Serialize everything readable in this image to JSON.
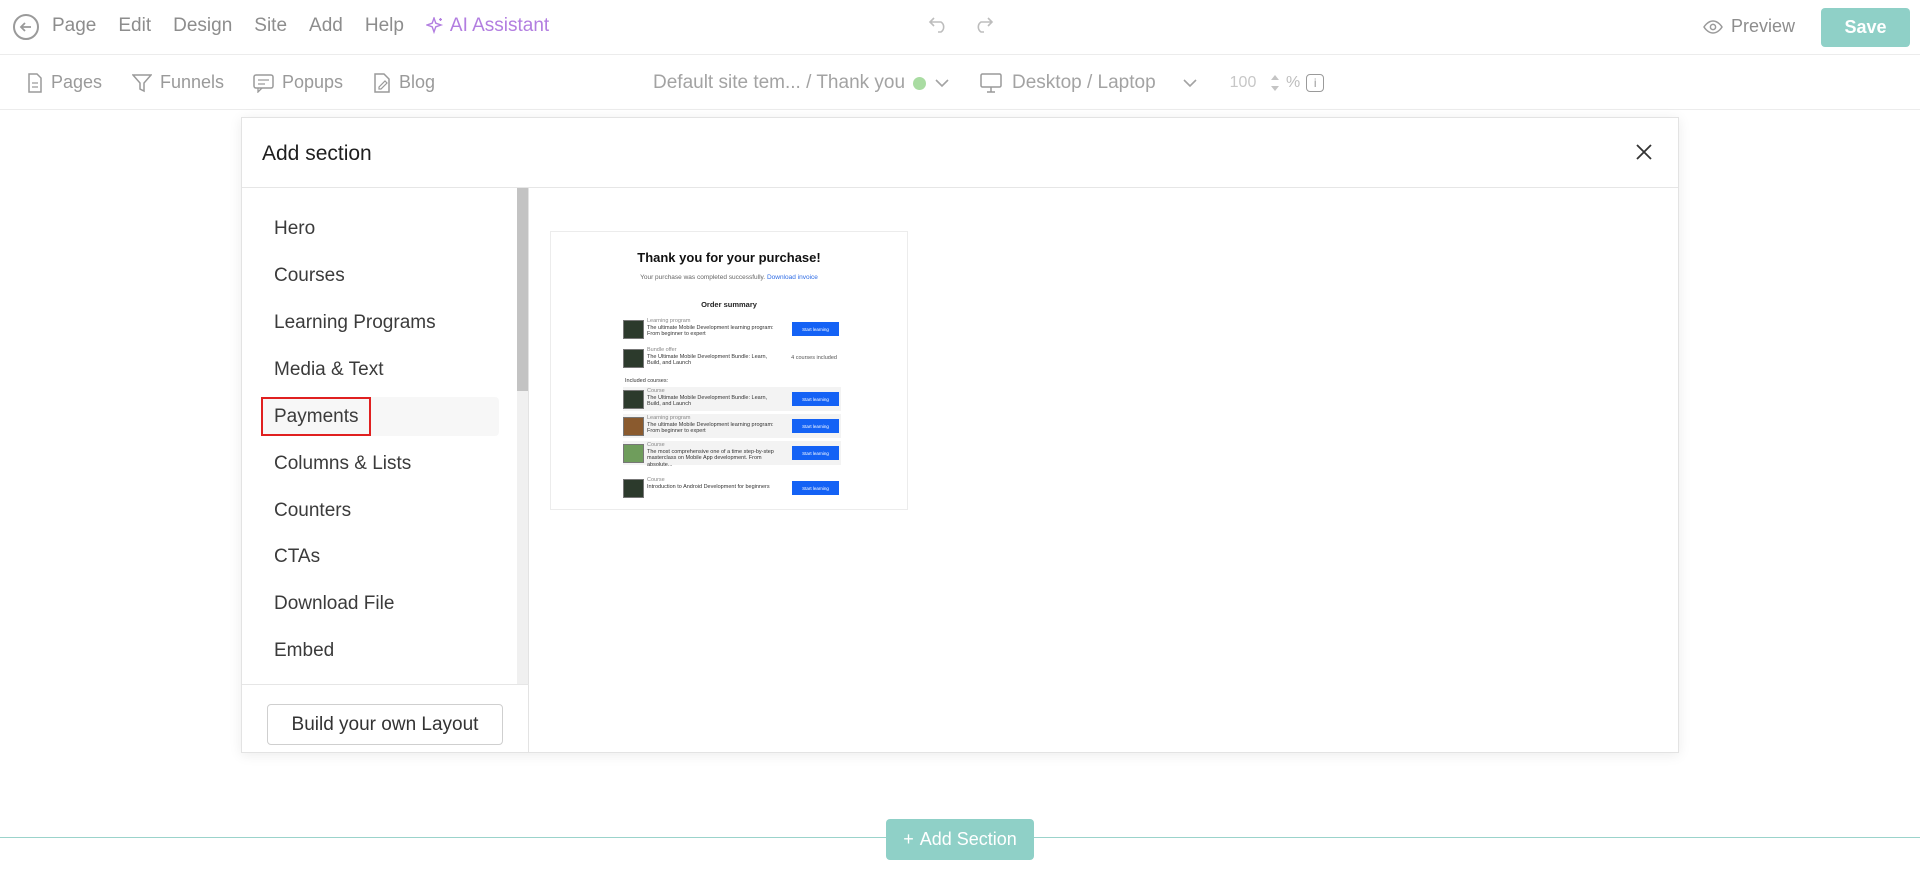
{
  "topbar": {
    "menu": [
      "Page",
      "Edit",
      "Design",
      "Site",
      "Add",
      "Help"
    ],
    "ai_label": "AI Assistant",
    "preview_label": "Preview",
    "save_label": "Save"
  },
  "subbar": {
    "nav": [
      "Pages",
      "Funnels",
      "Popups",
      "Blog"
    ],
    "breadcrumb": "Default site tem... / Thank you",
    "device": "Desktop / Laptop",
    "zoom_value": "100",
    "zoom_unit": "%"
  },
  "modal": {
    "title": "Add section",
    "categories": [
      "Hero",
      "Courses",
      "Learning Programs",
      "Media & Text",
      "Payments",
      "Columns & Lists",
      "Counters",
      "CTAs",
      "Download File",
      "Embed"
    ],
    "selected_category": "Payments",
    "build_label": "Build your own Layout",
    "preview": {
      "title": "Thank you for your purchase!",
      "subtitle": "Your purchase was completed successfully.",
      "subtitle_link": "Download invoice",
      "summary": "Order summary",
      "included": "Included courses:",
      "rows": [
        {
          "kind": "Learning program",
          "name": "The ultimate Mobile Development learning program: From beginner to expert",
          "action": "Start learning"
        },
        {
          "kind": "Bundle offer",
          "name": "The Ultimate Mobile Development Bundle: Learn, Build, and Launch",
          "action": "4 courses included"
        },
        {
          "kind": "Course",
          "name": "The Ultimate Mobile Development Bundle: Learn, Build, and Launch",
          "action": "Start learning"
        },
        {
          "kind": "Learning program",
          "name": "The ultimate Mobile Development learning program: From beginner to expert",
          "action": "Start learning"
        },
        {
          "kind": "Course",
          "name": "The most comprehensive one of a time step-by-step masterclass on Mobile App development. From absolute...",
          "action": "Start learning"
        },
        {
          "kind": "Course",
          "name": "Introduction to Android Development for beginners",
          "action": "Start learning"
        }
      ]
    }
  },
  "bottom": {
    "add_section_label": "Add Section"
  },
  "colors": {
    "accent": "#8fd0c7",
    "ai": "#b27ee0",
    "highlight": "#e02020",
    "button_blue": "#1462f5"
  }
}
